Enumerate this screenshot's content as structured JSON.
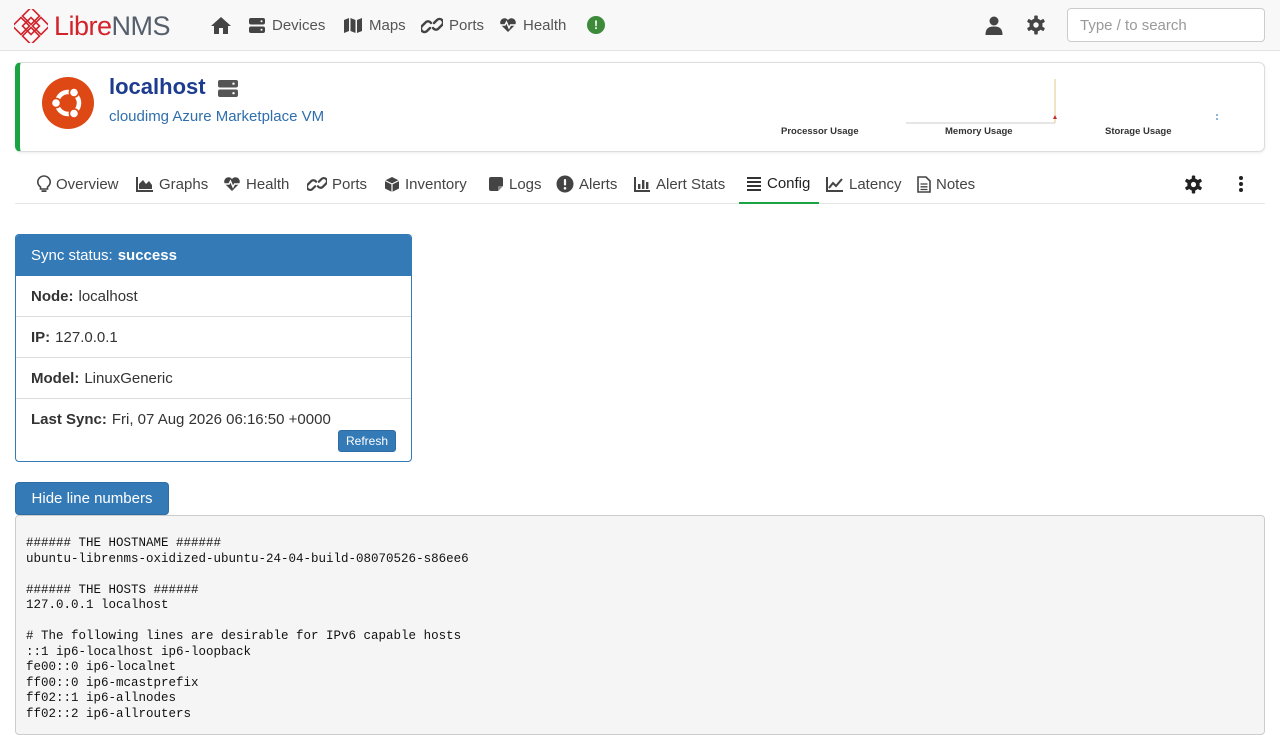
{
  "brand": {
    "libre": "Libre",
    "nms": "NMS",
    "accent": "#d2232a"
  },
  "nav": {
    "items": [
      {
        "label": "",
        "icon": "home-icon"
      },
      {
        "label": "Devices",
        "icon": "server-icon"
      },
      {
        "label": "Maps",
        "icon": "map-icon"
      },
      {
        "label": "Ports",
        "icon": "link-icon"
      },
      {
        "label": "Health",
        "icon": "heartbeat-icon"
      }
    ],
    "health_badge": "!",
    "search_placeholder": "Type / to search"
  },
  "device": {
    "name": "localhost",
    "description": "cloudimg Azure Marketplace VM",
    "status_color": "#1aa342",
    "os_icon": "ubuntu-icon",
    "graphs": [
      "Processor Usage",
      "Memory Usage",
      "Storage Usage"
    ]
  },
  "tabs": [
    {
      "label": "Overview",
      "icon": "lightbulb-icon"
    },
    {
      "label": "Graphs",
      "icon": "area-chart-icon"
    },
    {
      "label": "Health",
      "icon": "heartbeat-icon"
    },
    {
      "label": "Ports",
      "icon": "link-icon"
    },
    {
      "label": "Inventory",
      "icon": "cube-icon"
    },
    {
      "label": "Logs",
      "icon": "sticky-note-icon"
    },
    {
      "label": "Alerts",
      "icon": "exclamation-circle-icon"
    },
    {
      "label": "Alert Stats",
      "icon": "bar-chart-icon"
    },
    {
      "label": "Config",
      "icon": "list-icon",
      "active": true
    },
    {
      "label": "Latency",
      "icon": "line-chart-icon"
    },
    {
      "label": "Notes",
      "icon": "file-text-icon"
    }
  ],
  "sync": {
    "heading_label": "Sync status:",
    "heading_value": "success",
    "rows": [
      {
        "label": "Node:",
        "value": "localhost"
      },
      {
        "label": "IP:",
        "value": "127.0.0.1"
      },
      {
        "label": "Model:",
        "value": "LinuxGeneric"
      },
      {
        "label": "Last Sync:",
        "value": "Fri, 07 Aug 2026 06:16:50 +0000"
      }
    ],
    "refresh_label": "Refresh"
  },
  "toggle_lines_label": "Hide line numbers",
  "config_lines": [
    "###### THE HOSTNAME ######",
    "ubuntu-librenms-oxidized-ubuntu-24-04-build-08070526-s86ee6",
    "",
    "###### THE HOSTS ######",
    "127.0.0.1 localhost",
    "",
    "# The following lines are desirable for IPv6 capable hosts",
    "::1 ip6-localhost ip6-loopback",
    "fe00::0 ip6-localnet",
    "ff00::0 ip6-mcastprefix",
    "ff02::1 ip6-allnodes",
    "ff02::2 ip6-allrouters"
  ]
}
